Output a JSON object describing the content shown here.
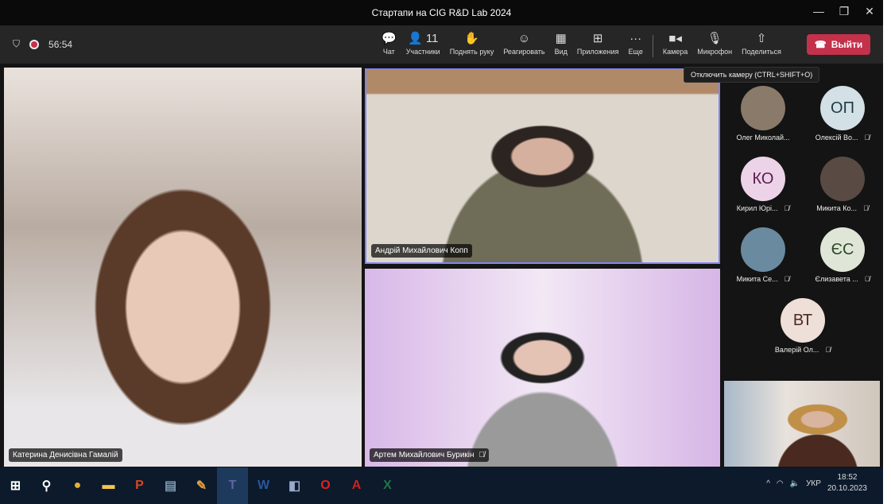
{
  "window": {
    "title": "Стартапи на CIG R&D Lab 2024"
  },
  "toolbar": {
    "timer": "56:54",
    "items": [
      {
        "icon": "chat-icon",
        "glyph": "💬",
        "label": "Чат"
      },
      {
        "icon": "people-icon",
        "glyph": "👤 11",
        "label": "Участники"
      },
      {
        "icon": "raise-hand-icon",
        "glyph": "✋",
        "label": "Поднять руку"
      },
      {
        "icon": "react-icon",
        "glyph": "☺",
        "label": "Реагировать"
      },
      {
        "icon": "view-icon",
        "glyph": "▦",
        "label": "Вид"
      },
      {
        "icon": "apps-icon",
        "glyph": "⊞",
        "label": "Приложения"
      },
      {
        "icon": "more-icon",
        "glyph": "···",
        "label": "Еще"
      }
    ],
    "items2": [
      {
        "icon": "camera-icon",
        "glyph": "■◂",
        "label": "Камера"
      },
      {
        "icon": "microphone-icon",
        "glyph": "🎙",
        "label": "Микрофон"
      },
      {
        "icon": "share-icon",
        "glyph": "⇧",
        "label": "Поделиться"
      }
    ],
    "leave_label": "Выйти",
    "tooltip": "Отключить камеру (CTRL+SHIFT+O)"
  },
  "tiles": [
    "Катерина Денисівна Гамалій",
    "Андрій Михайлович Копп",
    "Артем Михайлович Бурикін"
  ],
  "people": [
    {
      "name": "Олег Миколай...",
      "initials": "",
      "muted": false,
      "bg": "#8a7a6a"
    },
    {
      "name": "Олексій Во...",
      "initials": "ОП",
      "muted": true,
      "bg": "#d3e0e6",
      "fg": "#1f3a44"
    },
    {
      "name": "Кирил Юрі...",
      "initials": "КО",
      "muted": true,
      "bg": "#ecd3e8",
      "fg": "#5c1c4e"
    },
    {
      "name": "Микита Ко...",
      "initials": "",
      "muted": true,
      "bg": "#5a4a44"
    },
    {
      "name": "Микита Се...",
      "initials": "",
      "muted": true,
      "bg": "#6a8aa0"
    },
    {
      "name": "Єлизавета ...",
      "initials": "ЄС",
      "muted": true,
      "bg": "#dfe6d8",
      "fg": "#2f4a2a"
    },
    {
      "name": "Валерій Ол...",
      "initials": "ВТ",
      "muted": true,
      "bg": "#eedfd8",
      "fg": "#4a2a22"
    }
  ],
  "taskbar": {
    "apps": [
      {
        "icon": "start-icon",
        "glyph": "⊞",
        "color": "#fff"
      },
      {
        "icon": "search-icon",
        "glyph": "⚲",
        "color": "#fff"
      },
      {
        "icon": "chrome-icon",
        "glyph": "●",
        "color": "#e8b030"
      },
      {
        "icon": "explorer-icon",
        "glyph": "▬",
        "color": "#f2c84a"
      },
      {
        "icon": "powerpoint-icon",
        "glyph": "P",
        "color": "#d24726"
      },
      {
        "icon": "calculator-icon",
        "glyph": "▤",
        "color": "#7a9ab0"
      },
      {
        "icon": "paint-icon",
        "glyph": "✎",
        "color": "#e0a040"
      },
      {
        "icon": "teams-icon",
        "glyph": "T",
        "color": "#6264a7"
      },
      {
        "icon": "word-icon",
        "glyph": "W",
        "color": "#2b579a"
      },
      {
        "icon": "notes-icon",
        "glyph": "◧",
        "color": "#9ac"
      },
      {
        "icon": "opera-icon",
        "glyph": "O",
        "color": "#e02020"
      },
      {
        "icon": "acrobat-icon",
        "glyph": "A",
        "color": "#d0201a"
      },
      {
        "icon": "excel-icon",
        "glyph": "X",
        "color": "#217346"
      }
    ],
    "lang": "УКР",
    "time": "18:52",
    "date": "20.10.2023"
  }
}
